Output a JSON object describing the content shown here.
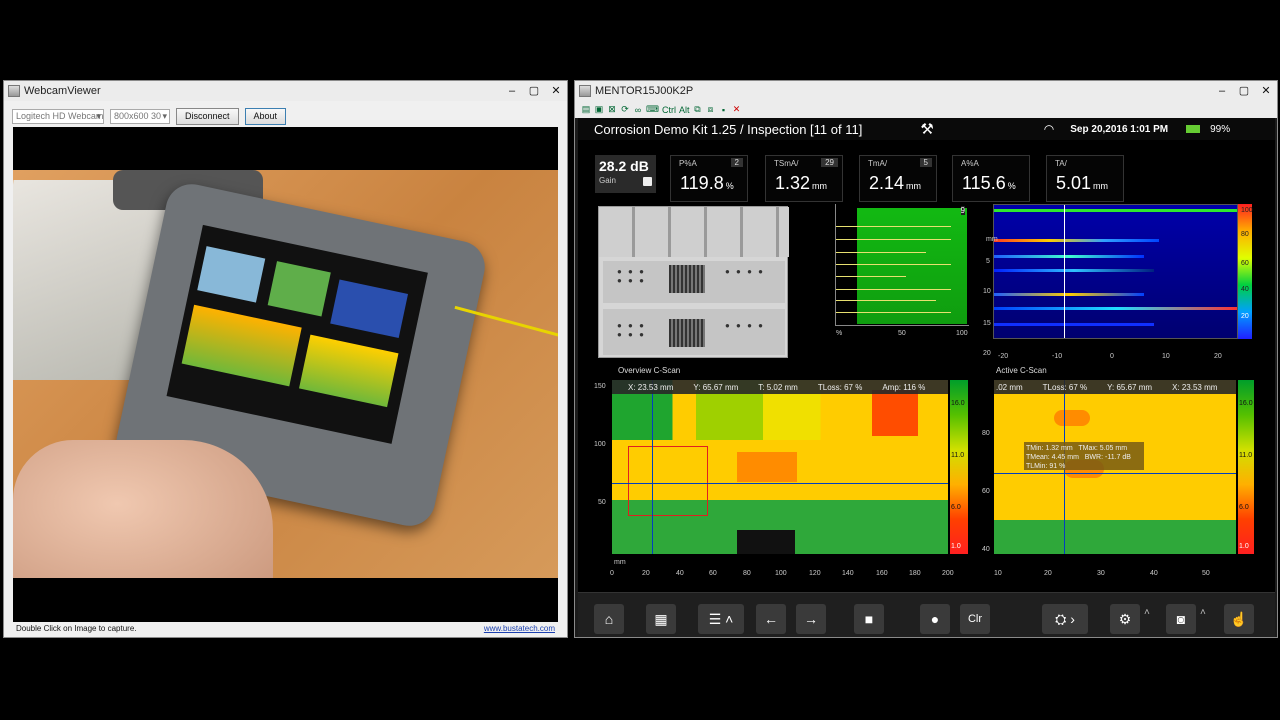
{
  "webcam": {
    "title": "WebcamViewer",
    "device": "Logitech HD Webcam C",
    "resolution": "800x600 30",
    "disconnect_label": "Disconnect",
    "about_label": "About",
    "footer_text": "Double Click on Image to capture.",
    "link_text": "www.bustatech.com"
  },
  "mentor": {
    "title": "MENTOR15J00K2P",
    "header": {
      "title": "Corrosion Demo Kit 1.25  / Inspection  [11 of 11]",
      "datetime": "Sep 20,2016  1:01 PM",
      "battery": "99%"
    },
    "gain": {
      "value": "28.2 dB",
      "label": "Gain"
    },
    "readings": [
      {
        "label": "P%A",
        "gate": "2",
        "value": "119.8",
        "unit": "%"
      },
      {
        "label": "TSmA/",
        "gate": "29",
        "value": "1.32",
        "unit": "mm"
      },
      {
        "label": "TmA/",
        "gate": "5",
        "value": "2.14",
        "unit": "mm"
      },
      {
        "label": "A%A",
        "gate": "",
        "value": "115.6",
        "unit": "%"
      },
      {
        "label": "TA/",
        "gate": "",
        "value": "5.01",
        "unit": "mm"
      }
    ],
    "ascan": {
      "x_ticks": [
        "%",
        "50",
        "100"
      ],
      "badge": "9"
    },
    "bscan": {
      "y_unit": "mm",
      "y_ticks": [
        "5",
        "10",
        "15",
        "20"
      ],
      "x_ticks": [
        "-20",
        "-10",
        "0",
        "10",
        "20"
      ],
      "colorbar_ticks": [
        "100",
        "80",
        "60",
        "40",
        "20"
      ]
    },
    "overview": {
      "title": "Overview C-Scan",
      "readout": [
        "X: 23.53 mm",
        "Y: 65.67 mm",
        "T: 5.02 mm",
        "TLoss: 67 %",
        "Amp: 116 %"
      ],
      "y_ticks": [
        "150",
        "100",
        "50"
      ],
      "x_ticks": [
        "0",
        "20",
        "40",
        "60",
        "80",
        "100",
        "120",
        "140",
        "160",
        "180",
        "200"
      ],
      "axis_unit": "mm",
      "colorbar_ticks": [
        "16.0",
        "11.0",
        "6.0",
        "1.0"
      ]
    },
    "active": {
      "title": "Active C-Scan",
      "readout": [
        ".02 mm",
        "TLoss: 67 %",
        "Y: 65.67 mm",
        "X: 23.53 mm"
      ],
      "stats": [
        "TMin: 1.32 mm",
        "TMax: 5.05 mm",
        "TMean: 4.45 mm",
        "BWR: -11.7 dB",
        "TLMin: 91 %"
      ],
      "y_ticks": [
        "80",
        "60",
        "40"
      ],
      "x_ticks": [
        "10",
        "20",
        "30",
        "40",
        "50"
      ],
      "colorbar_ticks": [
        "16.0",
        "11.0",
        "6.0",
        "1.0"
      ]
    },
    "toolbar_clr": "Clr"
  }
}
